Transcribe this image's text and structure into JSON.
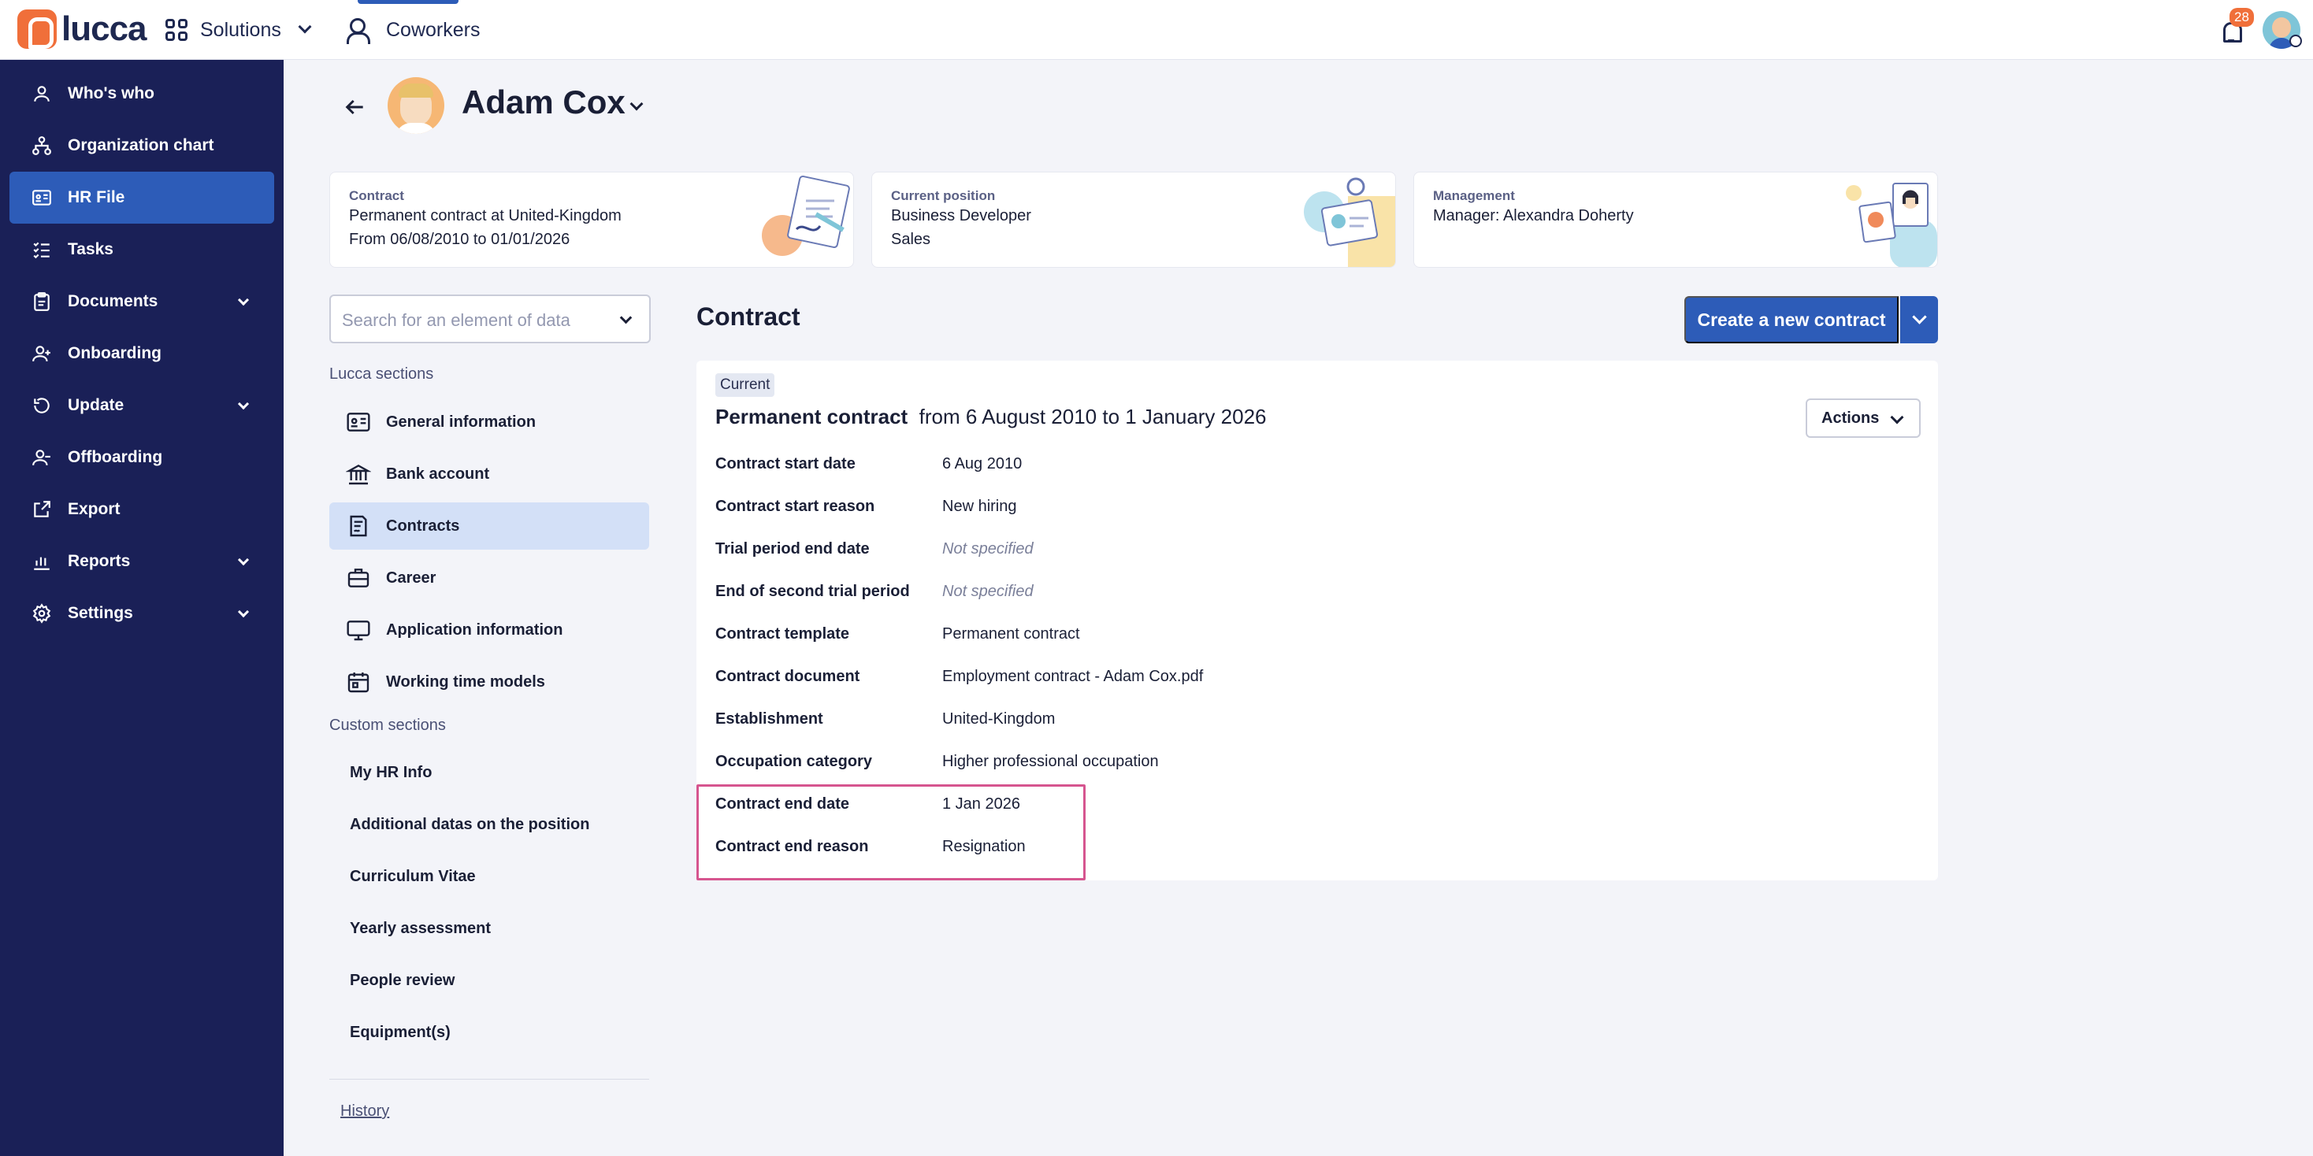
{
  "topbar": {
    "brand": "lucca",
    "solutions_label": "Solutions",
    "coworkers_label": "Coworkers",
    "notifications_count": "28"
  },
  "sidebar": {
    "items": [
      {
        "label": "Who's who",
        "icon": "person-icon"
      },
      {
        "label": "Organization chart",
        "icon": "org-chart-icon"
      },
      {
        "label": "HR File",
        "icon": "id-card-icon",
        "active": true
      },
      {
        "label": "Tasks",
        "icon": "checklist-icon"
      },
      {
        "label": "Documents",
        "icon": "clipboard-icon",
        "expandable": true
      },
      {
        "label": "Onboarding",
        "icon": "person-add-icon"
      },
      {
        "label": "Update",
        "icon": "refresh-icon",
        "expandable": true
      },
      {
        "label": "Offboarding",
        "icon": "person-remove-icon"
      },
      {
        "label": "Export",
        "icon": "export-icon"
      },
      {
        "label": "Reports",
        "icon": "bar-chart-icon",
        "expandable": true
      },
      {
        "label": "Settings",
        "icon": "gear-icon",
        "expandable": true
      }
    ]
  },
  "profile": {
    "name": "Adam Cox"
  },
  "cards": {
    "contract": {
      "label": "Contract",
      "line1": "Permanent contract at United-Kingdom",
      "line2": "From 06/08/2010 to 01/01/2026"
    },
    "position": {
      "label": "Current position",
      "line1": "Business Developer",
      "line2": "Sales"
    },
    "management": {
      "label": "Management",
      "line1": "Manager: Alexandra Doherty"
    }
  },
  "search": {
    "placeholder": "Search for an element of data"
  },
  "sections": {
    "lucca_title": "Lucca sections",
    "lucca_items": [
      {
        "label": "General information",
        "icon": "id-card-icon"
      },
      {
        "label": "Bank account",
        "icon": "bank-icon"
      },
      {
        "label": "Contracts",
        "icon": "contract-icon",
        "active": true
      },
      {
        "label": "Career",
        "icon": "briefcase-icon"
      },
      {
        "label": "Application information",
        "icon": "monitor-icon"
      },
      {
        "label": "Working time models",
        "icon": "calendar-icon"
      }
    ],
    "custom_title": "Custom sections",
    "custom_items": [
      "My HR Info",
      "Additional datas on the position",
      "Curriculum Vitae",
      "Yearly assessment",
      "People review",
      "Equipment(s)"
    ],
    "history_label": "History"
  },
  "main": {
    "title": "Contract",
    "create_button": "Create a new contract",
    "current_tag": "Current",
    "contract_type": "Permanent contract",
    "contract_period": "from 6 August 2010 to 1 January 2026",
    "actions_label": "Actions",
    "fields": [
      {
        "label": "Contract start date",
        "value": "6 Aug 2010"
      },
      {
        "label": "Contract start reason",
        "value": "New hiring"
      },
      {
        "label": "Trial period end date",
        "value": "Not specified",
        "empty": true
      },
      {
        "label": "End of second trial period",
        "value": "Not specified",
        "empty": true
      },
      {
        "label": "Contract template",
        "value": "Permanent contract"
      },
      {
        "label": "Contract document",
        "value": "Employment contract - Adam Cox.pdf"
      },
      {
        "label": "Establishment",
        "value": "United-Kingdom"
      },
      {
        "label": "Occupation category",
        "value": "Higher professional occupation"
      },
      {
        "label": "Contract end date",
        "value": "1 Jan 2026"
      },
      {
        "label": "Contract end reason",
        "value": "Resignation"
      }
    ]
  },
  "colors": {
    "sidebar_bg": "#1a2057",
    "primary": "#2d5cb8",
    "brand_orange": "#f06f3a",
    "highlight_border": "#d6558f"
  }
}
